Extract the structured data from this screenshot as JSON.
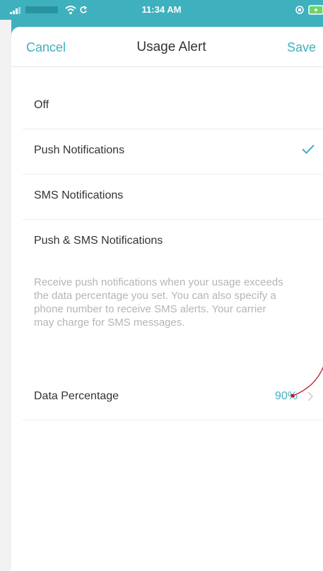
{
  "status_bar": {
    "time": "11:34 AM"
  },
  "nav": {
    "cancel_label": "Cancel",
    "title": "Usage Alert",
    "save_label": "Save"
  },
  "options": [
    {
      "label": "Off",
      "selected": false
    },
    {
      "label": "Push Notifications",
      "selected": true
    },
    {
      "label": "SMS Notifications",
      "selected": false
    },
    {
      "label": "Push & SMS Notifications",
      "selected": false
    }
  ],
  "description": "Receive push notifications when your usage exceeds the data percentage you set. You can also specify a phone number to receive SMS alerts. Your carrier may charge for SMS messages.",
  "data_percentage": {
    "label": "Data Percentage",
    "value": "90%"
  },
  "colors": {
    "accent": "#3fb0be",
    "annotation": "#c0182b"
  },
  "icons": [
    "signal-icon",
    "wifi-icon",
    "sync-icon",
    "battery-icon",
    "checkmark-icon",
    "chevron-right-icon"
  ]
}
